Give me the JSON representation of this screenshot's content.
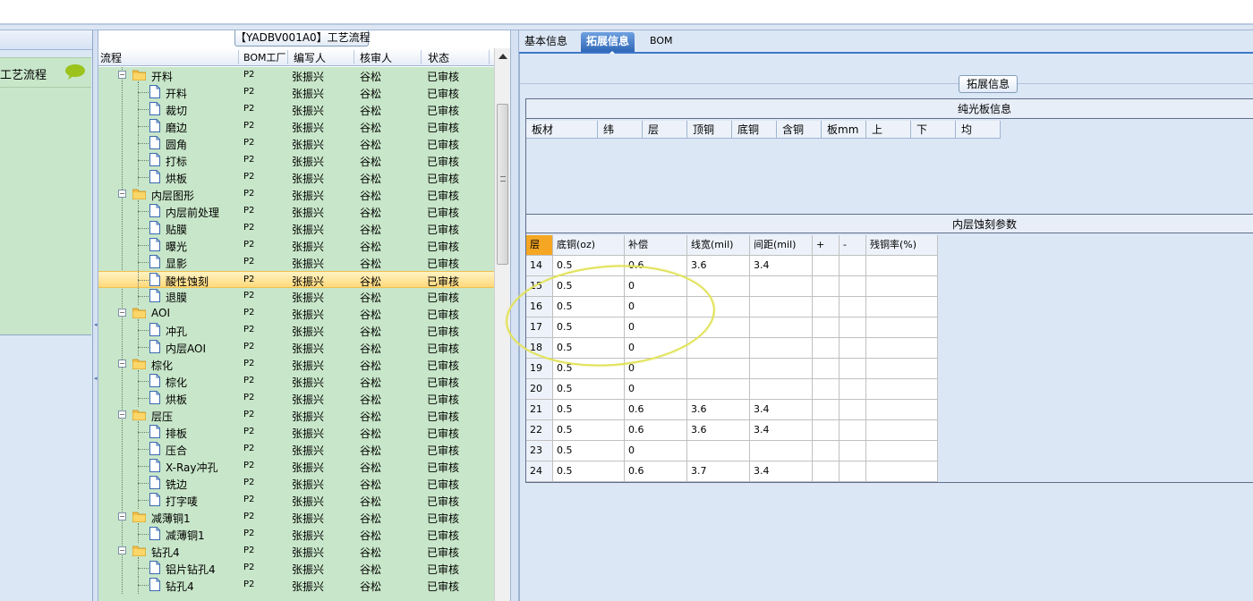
{
  "left_panel": {
    "item_label": "工艺流程",
    "chat_icon": "speech-bubble-icon"
  },
  "tree": {
    "caption": "【YADBV001A0】工艺流程",
    "columns": [
      "流程",
      "BOM工厂",
      "编写人",
      "核审人",
      "状态"
    ],
    "rows": [
      {
        "level": 0,
        "name": "开料",
        "bom": "P2",
        "author": "张振兴",
        "reviewer": "谷松",
        "status": "已审核"
      },
      {
        "level": 1,
        "name": "开料",
        "bom": "P2",
        "author": "张振兴",
        "reviewer": "谷松",
        "status": "已审核"
      },
      {
        "level": 1,
        "name": "裁切",
        "bom": "P2",
        "author": "张振兴",
        "reviewer": "谷松",
        "status": "已审核"
      },
      {
        "level": 1,
        "name": "磨边",
        "bom": "P2",
        "author": "张振兴",
        "reviewer": "谷松",
        "status": "已审核"
      },
      {
        "level": 1,
        "name": "圆角",
        "bom": "P2",
        "author": "张振兴",
        "reviewer": "谷松",
        "status": "已审核"
      },
      {
        "level": 1,
        "name": "打标",
        "bom": "P2",
        "author": "张振兴",
        "reviewer": "谷松",
        "status": "已审核"
      },
      {
        "level": 1,
        "name": "烘板",
        "bom": "P2",
        "author": "张振兴",
        "reviewer": "谷松",
        "status": "已审核"
      },
      {
        "level": 0,
        "name": "内层图形",
        "bom": "P2",
        "author": "张振兴",
        "reviewer": "谷松",
        "status": "已审核"
      },
      {
        "level": 1,
        "name": "内层前处理",
        "bom": "P2",
        "author": "张振兴",
        "reviewer": "谷松",
        "status": "已审核"
      },
      {
        "level": 1,
        "name": "贴膜",
        "bom": "P2",
        "author": "张振兴",
        "reviewer": "谷松",
        "status": "已审核"
      },
      {
        "level": 1,
        "name": "曝光",
        "bom": "P2",
        "author": "张振兴",
        "reviewer": "谷松",
        "status": "已审核"
      },
      {
        "level": 1,
        "name": "显影",
        "bom": "P2",
        "author": "张振兴",
        "reviewer": "谷松",
        "status": "已审核"
      },
      {
        "level": 1,
        "name": "酸性蚀刻",
        "bom": "P2",
        "author": "张振兴",
        "reviewer": "谷松",
        "status": "已审核",
        "selected": true
      },
      {
        "level": 1,
        "name": "退膜",
        "bom": "P2",
        "author": "张振兴",
        "reviewer": "谷松",
        "status": "已审核"
      },
      {
        "level": 0,
        "name": "AOI",
        "bom": "P2",
        "author": "张振兴",
        "reviewer": "谷松",
        "status": "已审核"
      },
      {
        "level": 1,
        "name": "冲孔",
        "bom": "P2",
        "author": "张振兴",
        "reviewer": "谷松",
        "status": "已审核"
      },
      {
        "level": 1,
        "name": "内层AOI",
        "bom": "P2",
        "author": "张振兴",
        "reviewer": "谷松",
        "status": "已审核"
      },
      {
        "level": 0,
        "name": "棕化",
        "bom": "P2",
        "author": "张振兴",
        "reviewer": "谷松",
        "status": "已审核"
      },
      {
        "level": 1,
        "name": "棕化",
        "bom": "P2",
        "author": "张振兴",
        "reviewer": "谷松",
        "status": "已审核"
      },
      {
        "level": 1,
        "name": "烘板",
        "bom": "P2",
        "author": "张振兴",
        "reviewer": "谷松",
        "status": "已审核"
      },
      {
        "level": 0,
        "name": "层压",
        "bom": "P2",
        "author": "张振兴",
        "reviewer": "谷松",
        "status": "已审核"
      },
      {
        "level": 1,
        "name": "排板",
        "bom": "P2",
        "author": "张振兴",
        "reviewer": "谷松",
        "status": "已审核"
      },
      {
        "level": 1,
        "name": "压合",
        "bom": "P2",
        "author": "张振兴",
        "reviewer": "谷松",
        "status": "已审核"
      },
      {
        "level": 1,
        "name": "X-Ray冲孔",
        "bom": "P2",
        "author": "张振兴",
        "reviewer": "谷松",
        "status": "已审核"
      },
      {
        "level": 1,
        "name": "铣边",
        "bom": "P2",
        "author": "张振兴",
        "reviewer": "谷松",
        "status": "已审核"
      },
      {
        "level": 1,
        "name": "打字唛",
        "bom": "P2",
        "author": "张振兴",
        "reviewer": "谷松",
        "status": "已审核"
      },
      {
        "level": 0,
        "name": "减薄铜1",
        "bom": "P2",
        "author": "张振兴",
        "reviewer": "谷松",
        "status": "已审核"
      },
      {
        "level": 1,
        "name": "减薄铜1",
        "bom": "P2",
        "author": "张振兴",
        "reviewer": "谷松",
        "status": "已审核"
      },
      {
        "level": 0,
        "name": "钻孔4",
        "bom": "P2",
        "author": "张振兴",
        "reviewer": "谷松",
        "status": "已审核"
      },
      {
        "level": 1,
        "name": "铝片钻孔4",
        "bom": "P2",
        "author": "张振兴",
        "reviewer": "谷松",
        "status": "已审核"
      },
      {
        "level": 1,
        "name": "钻孔4",
        "bom": "P2",
        "author": "张振兴",
        "reviewer": "谷松",
        "status": "已审核"
      }
    ]
  },
  "right": {
    "tabs": [
      "基本信息",
      "拓展信息",
      "BOM"
    ],
    "active_tab": 1,
    "group_caption": "拓展信息",
    "section1_title": "纯光板信息",
    "section1_columns": [
      "板材",
      "纬",
      "层",
      "顶铜",
      "底铜",
      "含铜",
      "板mm",
      "上",
      "下",
      "均"
    ],
    "section2_title": "内层蚀刻参数",
    "section2_columns": [
      "层",
      "底铜(oz)",
      "补偿",
      "线宽(mil)",
      "间距(mil)",
      "+",
      "-",
      "残铜率(%)"
    ],
    "section2_rows": [
      [
        "14",
        "0.5",
        "0.6",
        "3.6",
        "3.4",
        "",
        "",
        ""
      ],
      [
        "15",
        "0.5",
        "0",
        "",
        "",
        "",
        "",
        ""
      ],
      [
        "16",
        "0.5",
        "0",
        "",
        "",
        "",
        "",
        ""
      ],
      [
        "17",
        "0.5",
        "0",
        "",
        "",
        "",
        "",
        ""
      ],
      [
        "18",
        "0.5",
        "0",
        "",
        "",
        "",
        "",
        ""
      ],
      [
        "19",
        "0.5",
        "0",
        "",
        "",
        "",
        "",
        ""
      ],
      [
        "20",
        "0.5",
        "0",
        "",
        "",
        "",
        "",
        ""
      ],
      [
        "21",
        "0.5",
        "0.6",
        "3.6",
        "3.4",
        "",
        "",
        ""
      ],
      [
        "22",
        "0.5",
        "0.6",
        "3.6",
        "3.4",
        "",
        "",
        ""
      ],
      [
        "23",
        "0.5",
        "0",
        "",
        "",
        "",
        "",
        ""
      ],
      [
        "24",
        "0.5",
        "0.6",
        "3.7",
        "3.4",
        "",
        "",
        ""
      ]
    ]
  },
  "colors": {
    "tree_bg": "#c8e6c9",
    "selected_row": "#ffd97a",
    "active_tab": "#2f67b8",
    "annotation": "#e2e25a"
  }
}
